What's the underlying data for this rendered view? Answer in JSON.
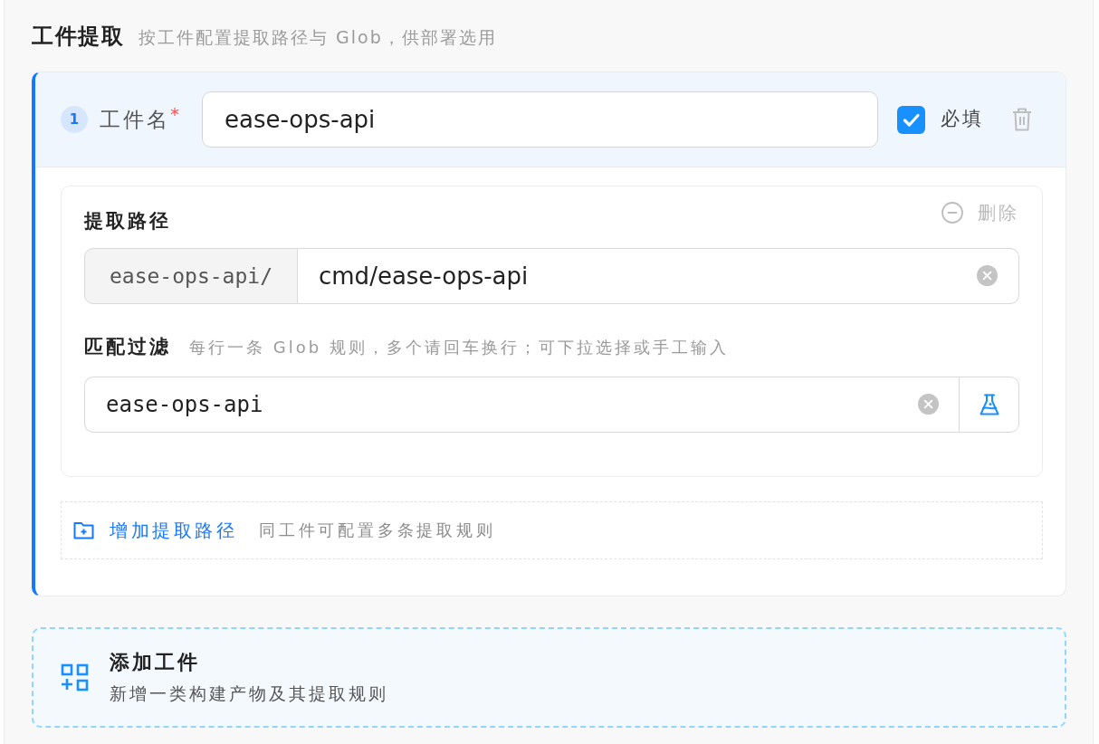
{
  "section": {
    "title": "工件提取",
    "subtitle": "按工件配置提取路径与 Glob，供部署选用"
  },
  "artifacts": [
    {
      "active": true,
      "index": "1",
      "name_label": "工件名",
      "required_mark": "*",
      "name_value": "ease-ops-api",
      "required": {
        "label": "必填",
        "checked": true
      },
      "paths": [
        {
          "title": "提取路径",
          "remove_label": "删除",
          "prefix": "ease-ops-api/",
          "path_value": "cmd/ease-ops-api",
          "filter_title": "匹配过滤",
          "filter_hint": "每行一条 Glob 规则，多个请回车换行；可下拉选择或手工输入",
          "filter_value": "ease-ops-api"
        }
      ],
      "add_path": {
        "label": "增加提取路径",
        "hint": "同工件可配置多条提取规则"
      }
    }
  ],
  "add_artifact": {
    "title": "添加工件",
    "subtitle": "新增一类构建产物及其提取规则"
  }
}
